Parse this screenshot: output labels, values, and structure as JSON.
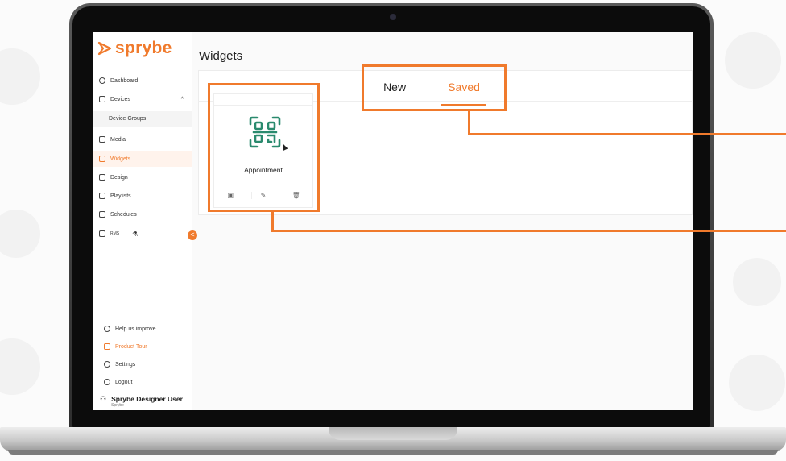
{
  "app": {
    "logo": "sprybe",
    "accent": "#f07a2c"
  },
  "sidebar": {
    "items": [
      {
        "label": "Dashboard",
        "icon": "dashboard-icon"
      },
      {
        "label": "Devices",
        "icon": "devices-icon",
        "chevron": "^"
      },
      {
        "label": "Device Groups"
      },
      {
        "label": "Media",
        "icon": "media-icon"
      },
      {
        "label": "Widgets",
        "icon": "widgets-icon"
      },
      {
        "label": "Design",
        "icon": "design-icon"
      },
      {
        "label": "Playlists",
        "icon": "playlists-icon"
      },
      {
        "label": "Schedules",
        "icon": "schedules-icon"
      },
      {
        "label": "RMS",
        "icon": "rms-icon"
      }
    ],
    "bottom": [
      {
        "label": "Help us improve",
        "icon": "help-icon"
      },
      {
        "label": "Product Tour",
        "icon": "tour-icon"
      },
      {
        "label": "Settings",
        "icon": "gear-icon"
      },
      {
        "label": "Logout",
        "icon": "logout-icon"
      }
    ],
    "user": {
      "name": "Sprybe Designer User",
      "org": "Sprybe"
    },
    "collapse_glyph": "<"
  },
  "main": {
    "title": "Widgets",
    "tabs": [
      {
        "label": "New"
      },
      {
        "label": "Saved"
      }
    ],
    "cards": [
      {
        "title": "Appointment",
        "icon": "qr-code-icon",
        "actions": [
          "preview-icon",
          "edit-icon",
          "delete-icon"
        ]
      }
    ]
  }
}
